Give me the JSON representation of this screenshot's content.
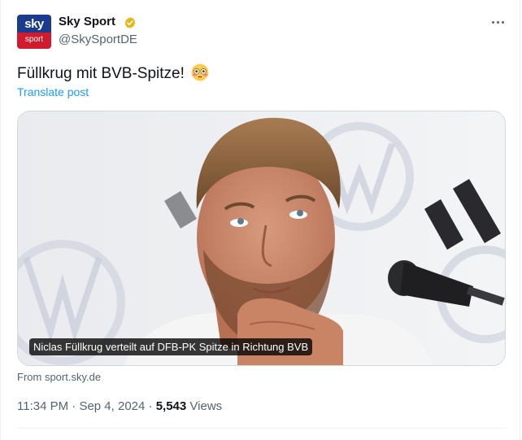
{
  "author": {
    "avatar_top": "sky",
    "avatar_bottom": "sport",
    "name": "Sky Sport",
    "handle": "@SkySportDE",
    "verified_icon": "gold-verified-check-icon"
  },
  "post": {
    "text": "Füllkrug mit BVB-Spitze!",
    "emoji": "flushed-face-emoji",
    "translate_label": "Translate post"
  },
  "media": {
    "caption": "Niclas Füllkrug verteilt auf DFB-PK Spitze in Richtung BVB",
    "source": "From sport.sky.de"
  },
  "meta": {
    "time": "11:34 PM",
    "separator": "·",
    "date": "Sep 4, 2024",
    "views_count": "5,543",
    "views_label": "Views"
  },
  "colors": {
    "accent": "#1d9bf0",
    "verified": "#e2b719",
    "secondary_text": "#536471"
  }
}
